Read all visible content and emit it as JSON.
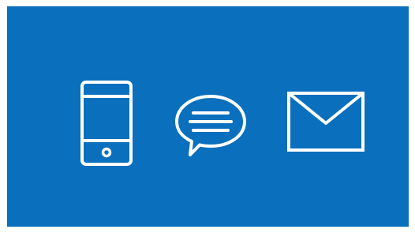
{
  "colors": {
    "background": "#ffffff",
    "banner": "#0a6fbd",
    "icon_stroke": "#ffffff"
  },
  "icons": [
    {
      "name": "mobile-phone-icon"
    },
    {
      "name": "chat-bubble-icon"
    },
    {
      "name": "envelope-icon"
    }
  ]
}
